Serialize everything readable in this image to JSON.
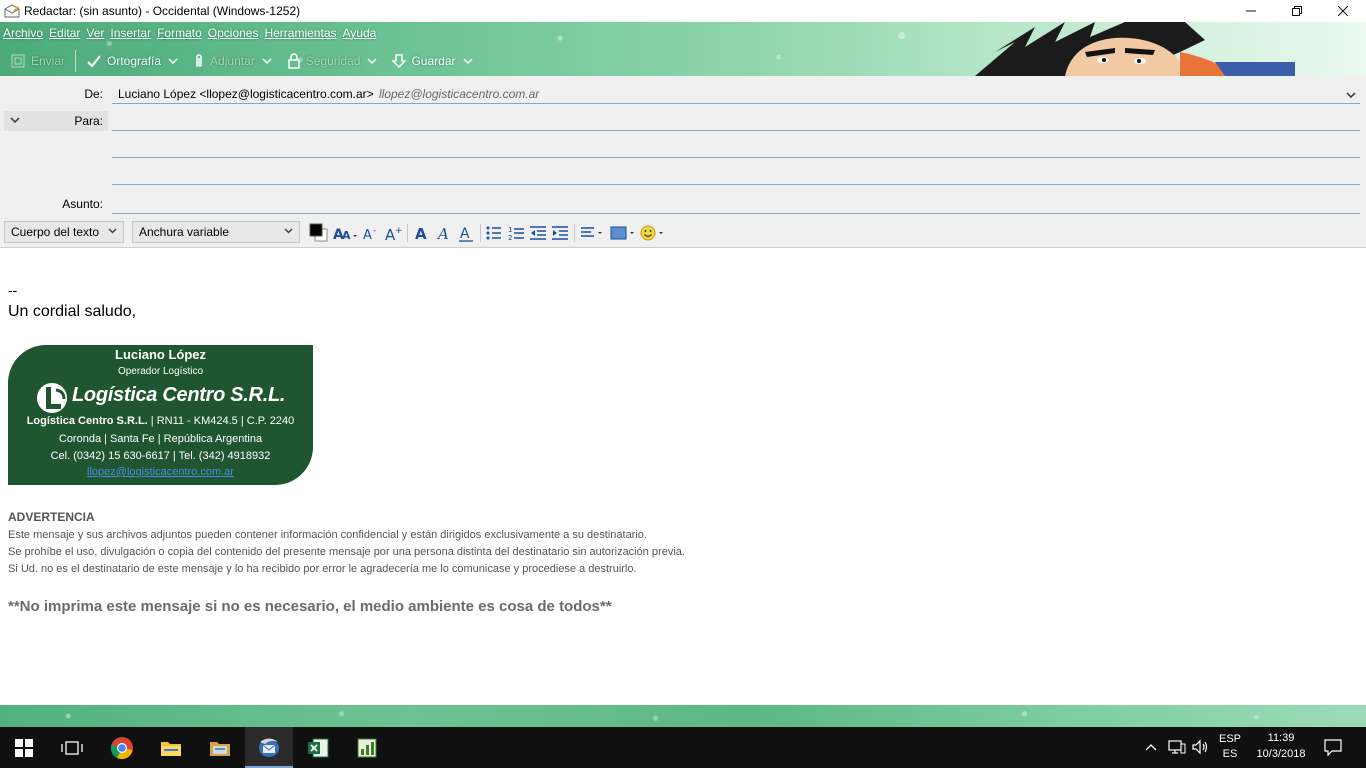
{
  "window": {
    "title": "Redactar: (sin asunto) - Occidental (Windows-1252)",
    "minimize_icon": "minimize-icon",
    "maximize_icon": "restore-icon",
    "close_icon": "close-icon"
  },
  "menu": [
    "Archivo",
    "Editar",
    "Ver",
    "Insertar",
    "Formato",
    "Opciones",
    "Herramientas",
    "Ayuda"
  ],
  "toolbar": {
    "send_label": "Enviar",
    "spelling_label": "Ortografía",
    "attach_label": "Adjuntar",
    "security_label": "Seguridad",
    "save_label": "Guardar"
  },
  "header": {
    "from_label": "De:",
    "from_value": "Luciano López <llopez@logisticacentro.com.ar>",
    "from_identity": "llopez@logisticacentro.com.ar",
    "to_label": "Para:",
    "to_value": "",
    "subject_label": "Asunto:",
    "subject_value": ""
  },
  "format": {
    "paragraph_style": "Cuerpo del texto",
    "font": "Anchura variable",
    "text_color": "#000000"
  },
  "body": {
    "sig_separator": "--",
    "greeting": "Un cordial saludo,",
    "signature": {
      "name": "Luciano López",
      "role": "Operador Logístico",
      "logo_text": "Logística Centro S.R.L.",
      "company": "Logística Centro S.R.L.",
      "address": "| RN11 - KM424.5 | C.P. 2240",
      "city": "Coronda | Santa Fe | República Argentina",
      "phones": "Cel. (0342) 15 630-6617 | Tel. (342) 4918932",
      "email": "llopez@logisticacentro.com.ar",
      "card_color": "#1f5630"
    },
    "warning_title": "ADVERTENCIA",
    "warning_lines": [
      "Este mensaje y sus archivos adjuntos pueden contener información confidencial y están dirigidos exclusivamente a su destinatario.",
      "Se prohíbe el uso, divulgación o copia del contenido del presente mensaje por una persona distinta del destinatario sin autorización previa.",
      "Si Ud. no es el destinatario de este mensaje y lo ha recibido por error le agradecería me lo comunicase y procediese a destruirlo."
    ],
    "eco_note": "**No imprima este mensaje si no es necesario, el medio ambiente es cosa de todos**"
  },
  "taskbar": {
    "apps": [
      "start-icon",
      "task-view-icon",
      "chrome-icon",
      "file-explorer-icon",
      "folder-icon",
      "thunderbird-icon",
      "excel-icon",
      "chart-app-icon"
    ],
    "language_top": "ESP",
    "language_bottom": "ES",
    "time": "11:39",
    "date": "10/3/2018"
  },
  "colors": {
    "theme_green": "#5cb885",
    "link_blue": "#4a8fe0",
    "taskbar": "#101010"
  }
}
